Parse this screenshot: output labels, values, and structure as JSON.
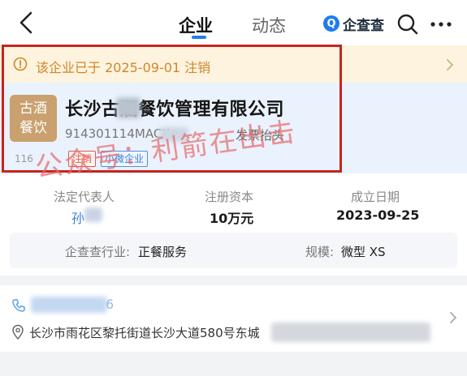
{
  "nav": {
    "tabs": [
      "企业",
      "动态"
    ],
    "brand": "企查查",
    "brand_logo": "Q"
  },
  "notice": {
    "text": "该企业已于 2025-09-01 注销"
  },
  "company": {
    "logo_line1": "古酒",
    "logo_line2": "餐饮",
    "name": "长沙古酒餐饮管理有限公司",
    "credit_code": "914301114MACX",
    "invoice_label": "发票抬头",
    "views": "116",
    "badges": [
      "注销",
      "小微企业"
    ]
  },
  "watermark": "公众号：利箭在出击",
  "stats": [
    {
      "label": "法定代表人",
      "value": "孙"
    },
    {
      "label": "注册资本",
      "value": "10万元"
    },
    {
      "label": "成立日期",
      "value": "2023-09-25"
    }
  ],
  "industry": {
    "label": "企查查行业:",
    "value": "正餐服务",
    "scale_label": "规模:",
    "scale_value": "微型 XS"
  },
  "contact": {
    "phone_tail": "6",
    "address": "长沙市雨花区黎托街道长沙大道580号东城"
  },
  "colors": {
    "accent": "#1f7cf0",
    "notice_text": "#d0862a",
    "notice_bg": "#fdf3de",
    "highlight_box": "#c5251f",
    "watermark": "#e86a6a"
  }
}
